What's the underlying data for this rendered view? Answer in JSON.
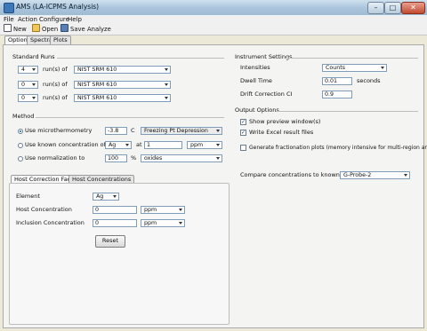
{
  "window": {
    "title": "AMS (LA-ICPMS Analysis)",
    "minimize": "–",
    "maximize": "□",
    "close": "✕"
  },
  "menu": [
    "File",
    "Action",
    "Configure",
    "Help"
  ],
  "toolbar": {
    "new": "New",
    "open": "Open",
    "save": "Save",
    "analyze": "Analyze"
  },
  "tabs": [
    "Options",
    "Spectra",
    "Plots"
  ],
  "standard_runs": {
    "title": "Standard Runs",
    "runs_label": "run(s) of",
    "rows": [
      {
        "count": "4",
        "standard": "NIST SRM 610"
      },
      {
        "count": "0",
        "standard": "NIST SRM 610"
      },
      {
        "count": "0",
        "standard": "NIST SRM 610"
      }
    ]
  },
  "method": {
    "title": "Method",
    "micro": {
      "label": "Use microthermometry",
      "value": "-3.8",
      "unit": "C",
      "mode": "Freezing Pt Depression",
      "selected": true
    },
    "known": {
      "label": "Use known concentration of",
      "element": "Ag",
      "at": "at",
      "value": "1",
      "unit": "ppm",
      "selected": false
    },
    "norm": {
      "label": "Use normalization to",
      "value": "100",
      "unit": "%",
      "basis": "oxides",
      "selected": false
    }
  },
  "host": {
    "tabs": [
      "Host Correction Factor",
      "Host Concentrations"
    ],
    "element_label": "Element",
    "element": "Ag",
    "host_conc_label": "Host Concentration",
    "host_conc": "0",
    "host_unit": "ppm",
    "incl_conc_label": "Inclusion Concentration",
    "incl_conc": "0",
    "incl_unit": "ppm",
    "reset": "Reset"
  },
  "instrument": {
    "title": "Instrument Settings",
    "intensities_label": "Intensities",
    "intensities": "Counts",
    "dwell_label": "Dwell Time",
    "dwell": "0.01",
    "dwell_unit": "seconds",
    "drift_label": "Drift Correction CI",
    "drift": "0.9"
  },
  "output": {
    "title": "Output Options",
    "options": [
      {
        "label": "Show preview window(s)",
        "checked": true
      },
      {
        "label": "Write Excel result files",
        "checked": true
      },
      {
        "label": "Generate fractionation plots (memory intensive for multi-region analyses)",
        "checked": false
      }
    ],
    "compare_label": "Compare concentrations to known",
    "compare": "G-Probe-2"
  }
}
